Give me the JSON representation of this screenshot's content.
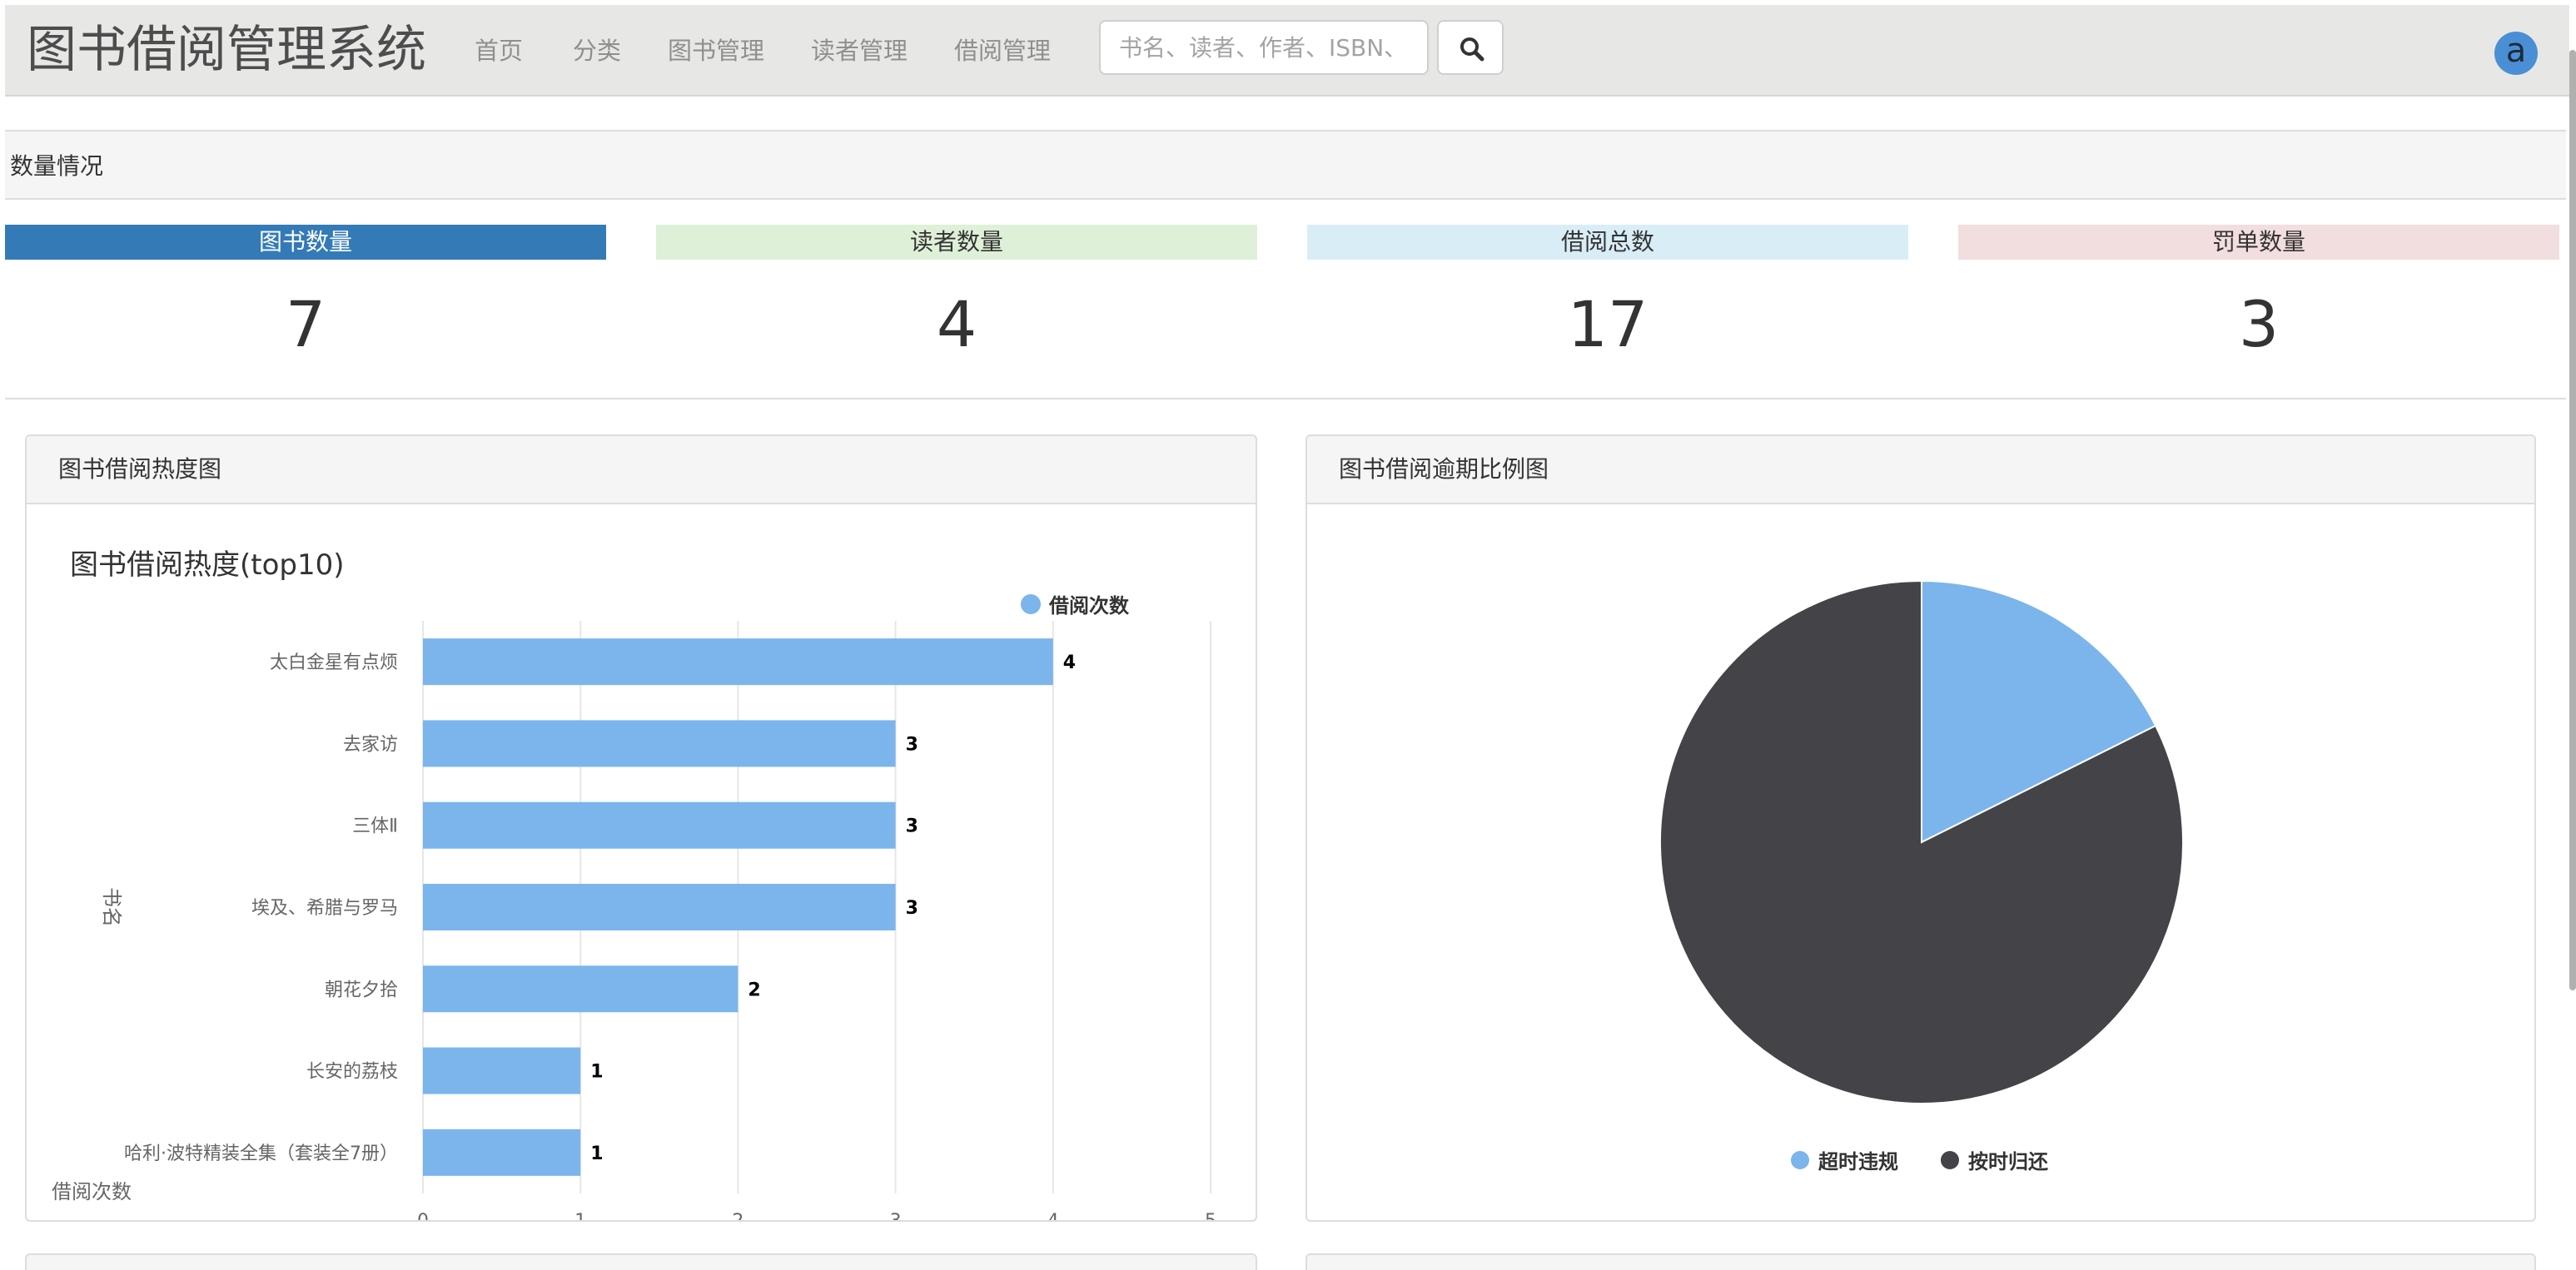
{
  "navbar": {
    "brand": "图书借阅管理系统",
    "items": [
      "首页",
      "分类",
      "图书管理",
      "读者管理",
      "借阅管理"
    ],
    "search_placeholder": "书名、读者、作者、ISBN、",
    "avatar_letter": "a"
  },
  "section": {
    "title": "数量情况"
  },
  "stats": [
    {
      "label": "图书数量",
      "value": "7",
      "bg": "#337ab7",
      "fg": "#ffffff"
    },
    {
      "label": "读者数量",
      "value": "4",
      "bg": "#dff0d8",
      "fg": "#333333"
    },
    {
      "label": "借阅总数",
      "value": "17",
      "bg": "#d9edf7",
      "fg": "#333333"
    },
    {
      "label": "罚单数量",
      "value": "3",
      "bg": "#f2dede",
      "fg": "#333333"
    }
  ],
  "panels": {
    "bar_title": "图书借阅热度图",
    "pie_title": "图书借阅逾期比例图"
  },
  "chart_data": [
    {
      "type": "bar",
      "orientation": "horizontal",
      "title": "图书借阅热度(top10)",
      "ylabel": "书名",
      "xlabel": "借阅次数",
      "categories": [
        "太白金星有点烦",
        "去家访",
        "三体Ⅱ",
        "埃及、希腊与罗马",
        "朝花夕拾",
        "长安的荔枝",
        "哈利·波特精装全集（套装全7册）"
      ],
      "series": [
        {
          "name": "借阅次数",
          "values": [
            4,
            3,
            3,
            3,
            2,
            1,
            1
          ],
          "color": "#7cb5ec"
        }
      ],
      "xlim": [
        0,
        5
      ],
      "xticks": [
        0,
        1,
        2,
        3,
        4,
        5
      ],
      "grid": true,
      "legend": "top-right",
      "data_labels": true
    },
    {
      "type": "pie",
      "slices": [
        {
          "name": "超时违规",
          "value": 3,
          "color": "#7cb5ec"
        },
        {
          "name": "按时归还",
          "value": 14,
          "color": "#434348"
        }
      ],
      "legend": "bottom-center"
    }
  ]
}
